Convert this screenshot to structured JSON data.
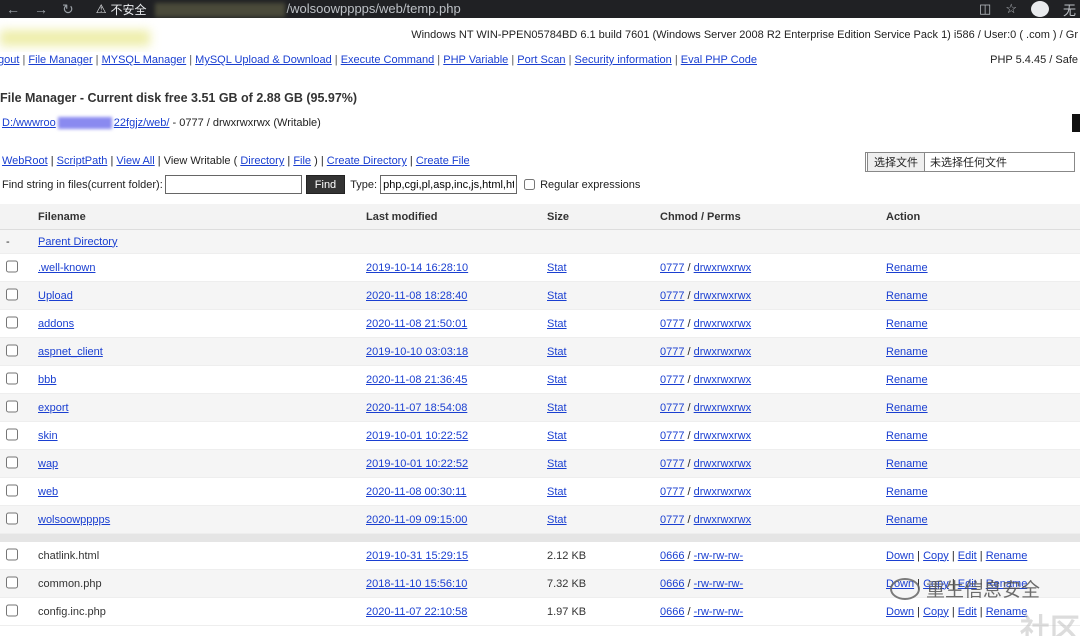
{
  "browser": {
    "insecure_label": "不安全",
    "url_path": "/wolsoowpppps/web/temp.php",
    "right_text": "无"
  },
  "header": {
    "sysinfo": "Windows NT WIN-PPEN05784BD 6.1 build 7601 (Windows Server 2008 R2 Enterprise Edition Service Pack 1) i586 / User:0 (          .com ) / Gr"
  },
  "menu": {
    "items": [
      "gout",
      "File Manager",
      "MYSQL Manager",
      "MySQL Upload & Download",
      "Execute Command",
      "PHP Variable",
      "Port Scan",
      "Security information",
      "Eval PHP Code"
    ],
    "php": "PHP 5.4.45 / Safe"
  },
  "title": "File Manager - Current disk free 3.51 GB of 2.88 GB (95.97%)",
  "path": {
    "prefix": "D:/wwwroo",
    "suffix": "22fgjz/web/",
    "perms": " - 0777 / drwxrwxrwx (Writable)"
  },
  "tools": {
    "webroot": "WebRoot",
    "scriptpath": "ScriptPath",
    "viewall": "View All",
    "viewwritable": "View Writable (",
    "directory": "Directory",
    "file": "File",
    "close": ")",
    "createdir": "Create Directory",
    "createfile": "Create File"
  },
  "upload": {
    "button": "选择文件",
    "label": "未选择任何文件"
  },
  "find": {
    "label": "Find string in files(current folder):",
    "value": "",
    "button": "Find",
    "type_label": "Type:",
    "type_value": "php,cgi,pl,asp,inc,js,html,htm",
    "regex_label": "Regular expressions"
  },
  "table": {
    "headers": {
      "filename": "Filename",
      "modified": "Last modified",
      "size": "Size",
      "perms": "Chmod / Perms",
      "action": "Action"
    },
    "parent": {
      "dash": "-",
      "label": "Parent Directory"
    },
    "dirs": [
      {
        "name": ".well-known",
        "modified": "2019-10-14 16:28:10",
        "size": "Stat",
        "chmod": "0777",
        "perms": "drwxrwxrwx",
        "action": "Rename"
      },
      {
        "name": "Upload",
        "modified": "2020-11-08 18:28:40",
        "size": "Stat",
        "chmod": "0777",
        "perms": "drwxrwxrwx",
        "action": "Rename"
      },
      {
        "name": "addons",
        "modified": "2020-11-08 21:50:01",
        "size": "Stat",
        "chmod": "0777",
        "perms": "drwxrwxrwx",
        "action": "Rename"
      },
      {
        "name": "aspnet_client",
        "modified": "2019-10-10 03:03:18",
        "size": "Stat",
        "chmod": "0777",
        "perms": "drwxrwxrwx",
        "action": "Rename"
      },
      {
        "name": "bbb",
        "modified": "2020-11-08 21:36:45",
        "size": "Stat",
        "chmod": "0777",
        "perms": "drwxrwxrwx",
        "action": "Rename"
      },
      {
        "name": "export",
        "modified": "2020-11-07 18:54:08",
        "size": "Stat",
        "chmod": "0777",
        "perms": "drwxrwxrwx",
        "action": "Rename"
      },
      {
        "name": "skin",
        "modified": "2019-10-01 10:22:52",
        "size": "Stat",
        "chmod": "0777",
        "perms": "drwxrwxrwx",
        "action": "Rename"
      },
      {
        "name": "wap",
        "modified": "2019-10-01 10:22:52",
        "size": "Stat",
        "chmod": "0777",
        "perms": "drwxrwxrwx",
        "action": "Rename"
      },
      {
        "name": "web",
        "modified": "2020-11-08 00:30:11",
        "size": "Stat",
        "chmod": "0777",
        "perms": "drwxrwxrwx",
        "action": "Rename"
      },
      {
        "name": "wolsoowpppps",
        "modified": "2020-11-09 09:15:00",
        "size": "Stat",
        "chmod": "0777",
        "perms": "drwxrwxrwx",
        "action": "Rename"
      }
    ],
    "files": [
      {
        "name": "chatlink.html",
        "modified": "2019-10-31 15:29:15",
        "size": "2.12 KB",
        "chmod": "0666",
        "perms": "-rw-rw-rw-",
        "down": "Down",
        "copy": "Copy",
        "edit": "Edit",
        "rename": "Rename"
      },
      {
        "name": "common.php",
        "modified": "2018-11-10 15:56:10",
        "size": "7.32 KB",
        "chmod": "0666",
        "perms": "-rw-rw-rw-",
        "down": "Down",
        "copy": "Copy",
        "edit": "Edit",
        "rename": "Rename"
      },
      {
        "name": "config.inc.php",
        "modified": "2020-11-07 22:10:58",
        "size": "1.97 KB",
        "chmod": "0666",
        "perms": "-rw-rw-rw-",
        "down": "Down",
        "copy": "Copy",
        "edit": "Edit",
        "rename": "Rename"
      }
    ]
  },
  "watermark": {
    "text": "重生信息安全",
    "text2": "社区"
  }
}
